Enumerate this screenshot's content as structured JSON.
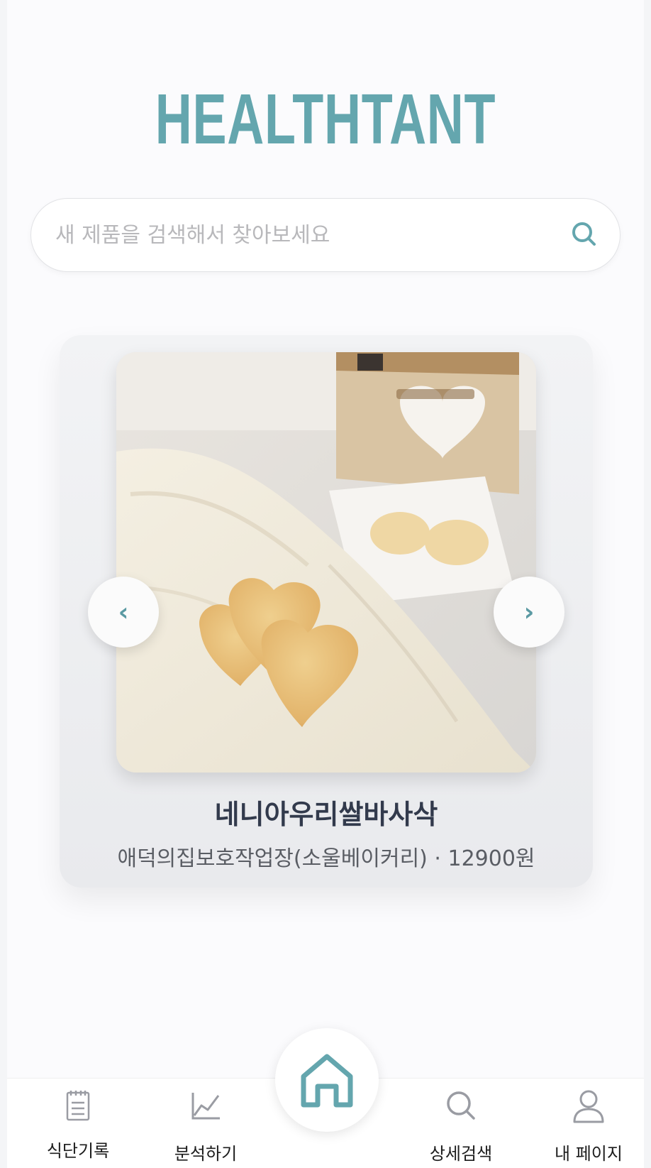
{
  "app": {
    "logo_text": "HEALTHTANT"
  },
  "search": {
    "placeholder": "새 제품을 검색해서 찾아보세요",
    "icon": "search-icon"
  },
  "carousel": {
    "prev_label": "‹",
    "next_label": "›",
    "product": {
      "name": "네니아우리쌀바사삭",
      "meta": "애덕의집보호작업장(소울베이커리) · 12900원",
      "image": "heart-shaped cookies on cloth with product box"
    }
  },
  "nav": {
    "items": [
      {
        "label": "식단기록",
        "icon": "clipboard-icon"
      },
      {
        "label": "분석하기",
        "icon": "chart-icon"
      },
      {
        "label": "",
        "icon": "home-icon"
      },
      {
        "label": "상세검색",
        "icon": "search-icon"
      },
      {
        "label": "내 페이지",
        "icon": "user-icon"
      }
    ]
  },
  "colors": {
    "accent": "#64a6ae",
    "nav_icon": "#9a9ca3",
    "title_text": "#323a4c"
  }
}
